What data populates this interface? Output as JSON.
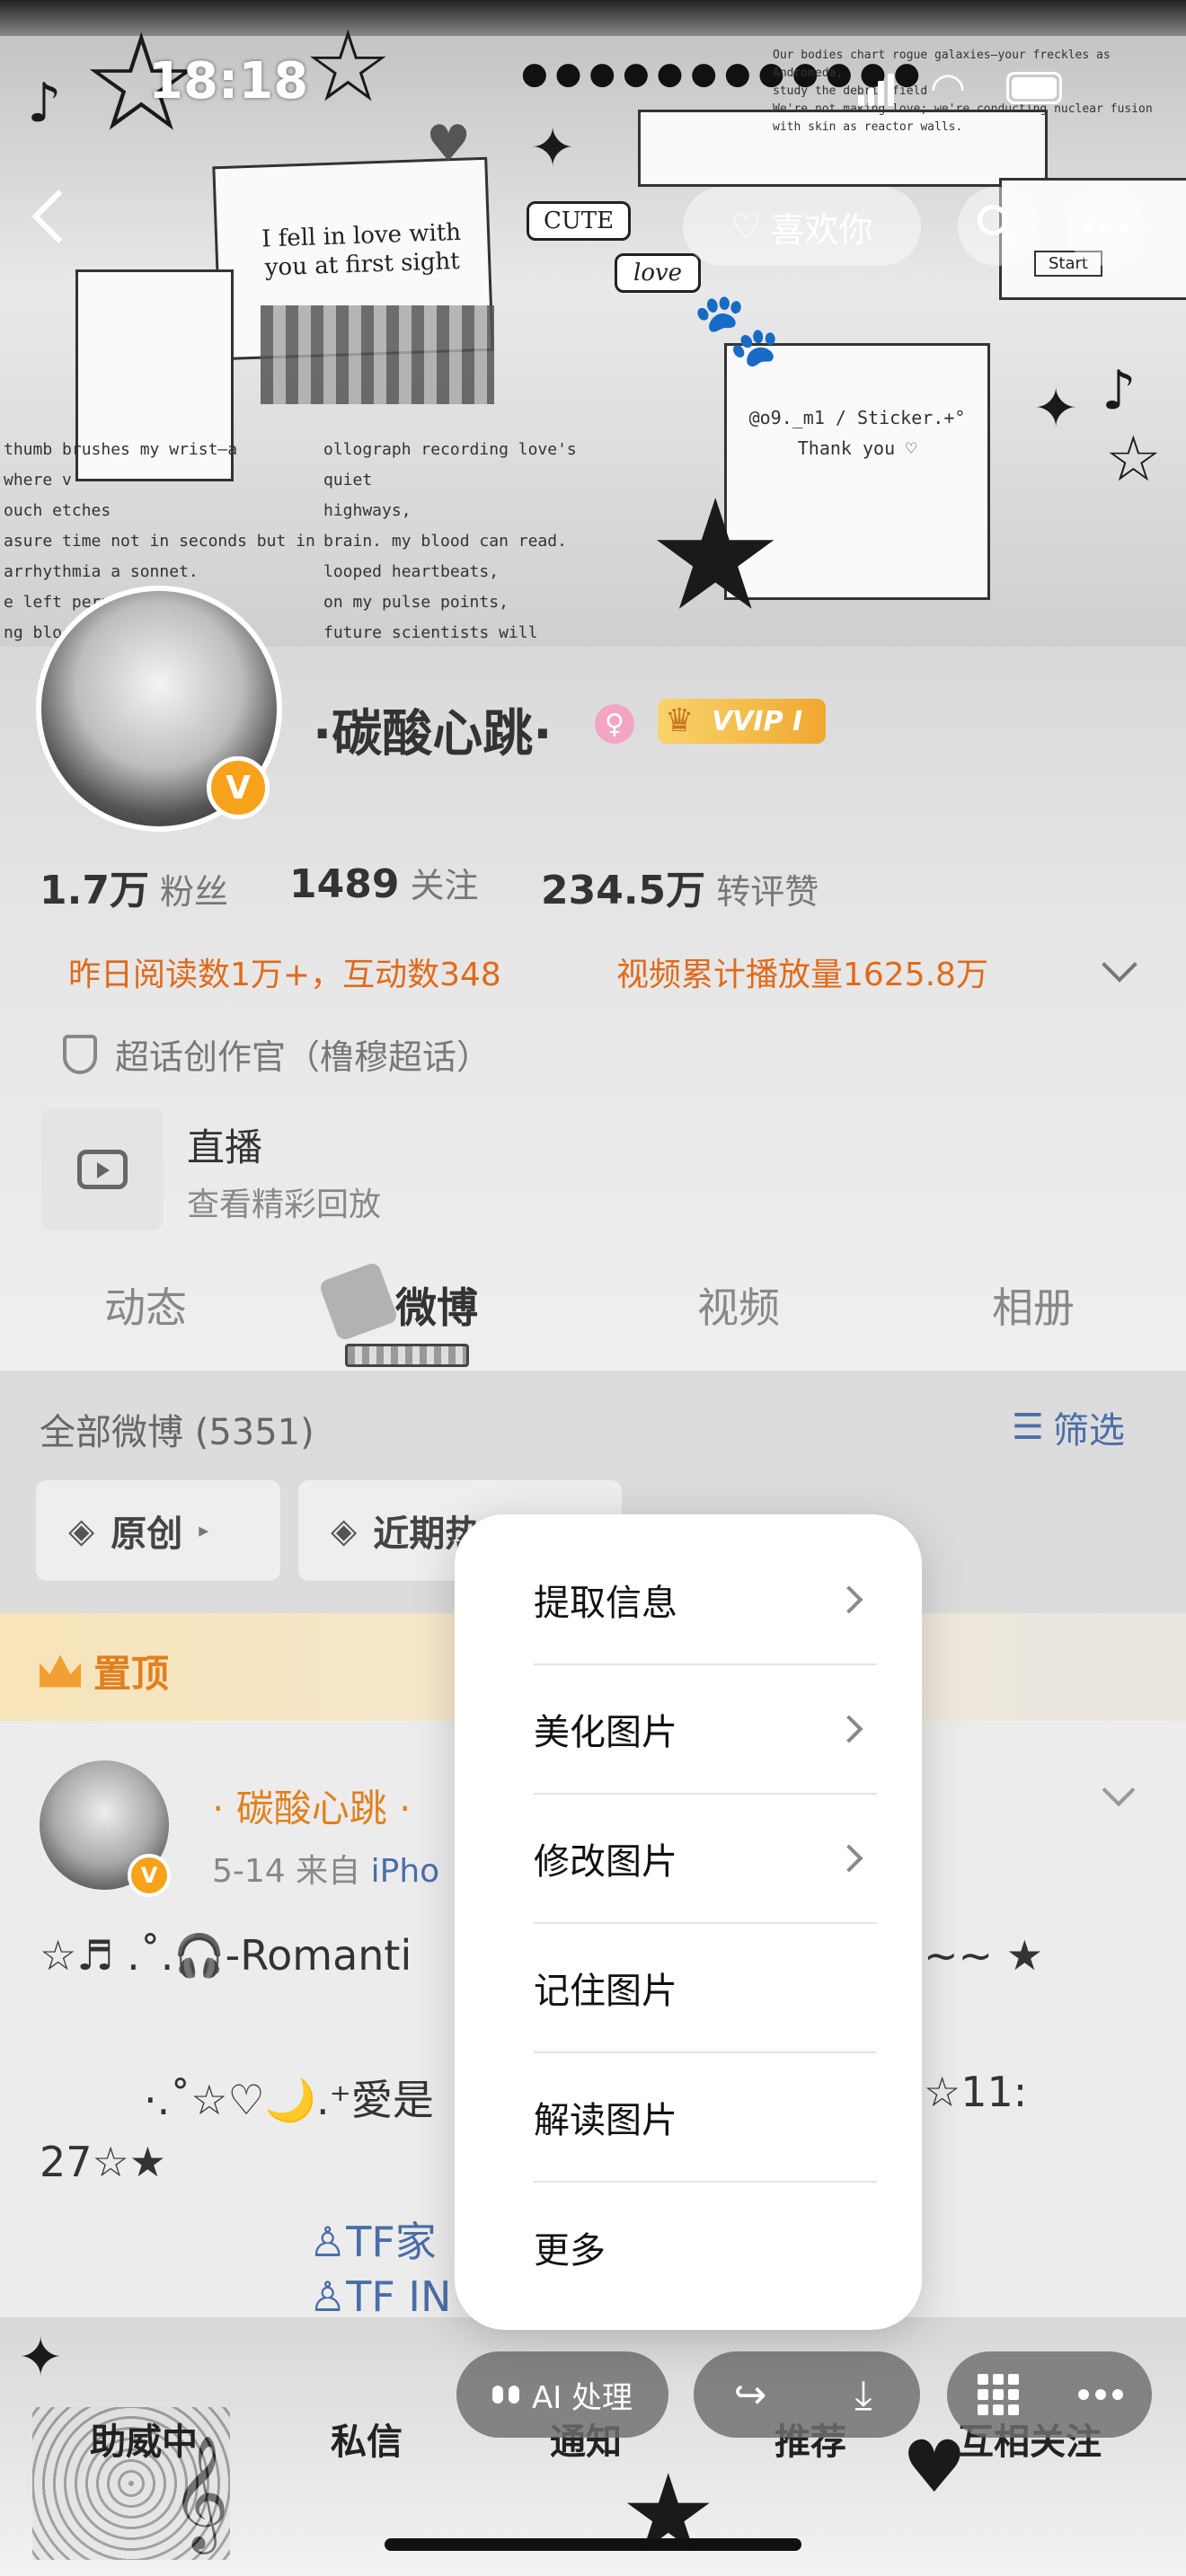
{
  "status_bar": {
    "time": "18:18"
  },
  "header": {
    "follow_label": "喜欢你",
    "sticker_texts": [
      "I fell in love with you at first sight",
      "CUTE",
      "love",
      "@o9._m1 / Sticker.+°",
      "Thank you ♡",
      "Start"
    ],
    "collage_lines": [
      "thumb brushes my wrist—a",
      "where v",
      "ouch etches",
      "asure time not in seconds but in",
      "arrhythmia a sonnet.",
      "e left pern",
      "ng blood",
      "ollograph recording love's quiet",
      "highways,",
      "brain. my blood can read.",
      "looped heartbeats,",
      "on my pulse points,",
      "future scientists will carbon-date this ecstasy.",
      "Our bodies chart rogue galaxies—your freckles as Andromeda,",
      "study the debris field",
      "We're not making love; we're conducting nuclear fusion with skin as reactor walls."
    ]
  },
  "profile": {
    "username": "·碳酸心跳·",
    "vip_label": "VVIP I",
    "stats": [
      {
        "num": "1.7万",
        "label": "粉丝"
      },
      {
        "num": "1489",
        "label": "关注"
      },
      {
        "num": "234.5万",
        "label": "转评赞"
      }
    ],
    "read_stat": "昨日阅读数1万+，互动数348",
    "video_stat": "视频累计播放量1625.8万",
    "super_topic": "超话创作官（橹穆超话）",
    "live_title": "直播",
    "live_sub": "查看精彩回放"
  },
  "tabs": [
    "动态",
    "微博",
    "视频",
    "相册"
  ],
  "feed": {
    "count_label": "全部微博 (5351)",
    "filter_label": "筛选",
    "chip_original": "原创",
    "chip_recent": "近期热",
    "pinned_label": "置顶",
    "post": {
      "name": "· 碳酸心跳 ·",
      "date": "5-14",
      "source_prefix": "来自",
      "source": "iPho",
      "line1": "☆♬ .˚.🎧-Romanti",
      "line1_tail": "~~ ★",
      "line2": "·.˚☆♡🌙.⁺愛是",
      "line2_tail": "☆11:",
      "line3": "27☆★",
      "tag1": "TF家",
      "tag2": "TF IN"
    }
  },
  "context_menu": {
    "items": [
      {
        "label": "提取信息",
        "has_arrow": true
      },
      {
        "label": "美化图片",
        "has_arrow": true
      },
      {
        "label": "修改图片",
        "has_arrow": true
      },
      {
        "label": "记住图片",
        "has_arrow": false
      },
      {
        "label": "解读图片",
        "has_arrow": false
      },
      {
        "label": "更多",
        "has_arrow": false
      }
    ]
  },
  "floating_tools": {
    "ai_label": "AI 处理"
  },
  "bottom_bar": {
    "items": [
      "助威中",
      "私信",
      "通知",
      "推荐",
      "互相关注"
    ]
  },
  "colors": {
    "accent_orange": "#e0801e",
    "link_blue": "#4a6ea8",
    "badge_gold": "#f7a21b"
  }
}
